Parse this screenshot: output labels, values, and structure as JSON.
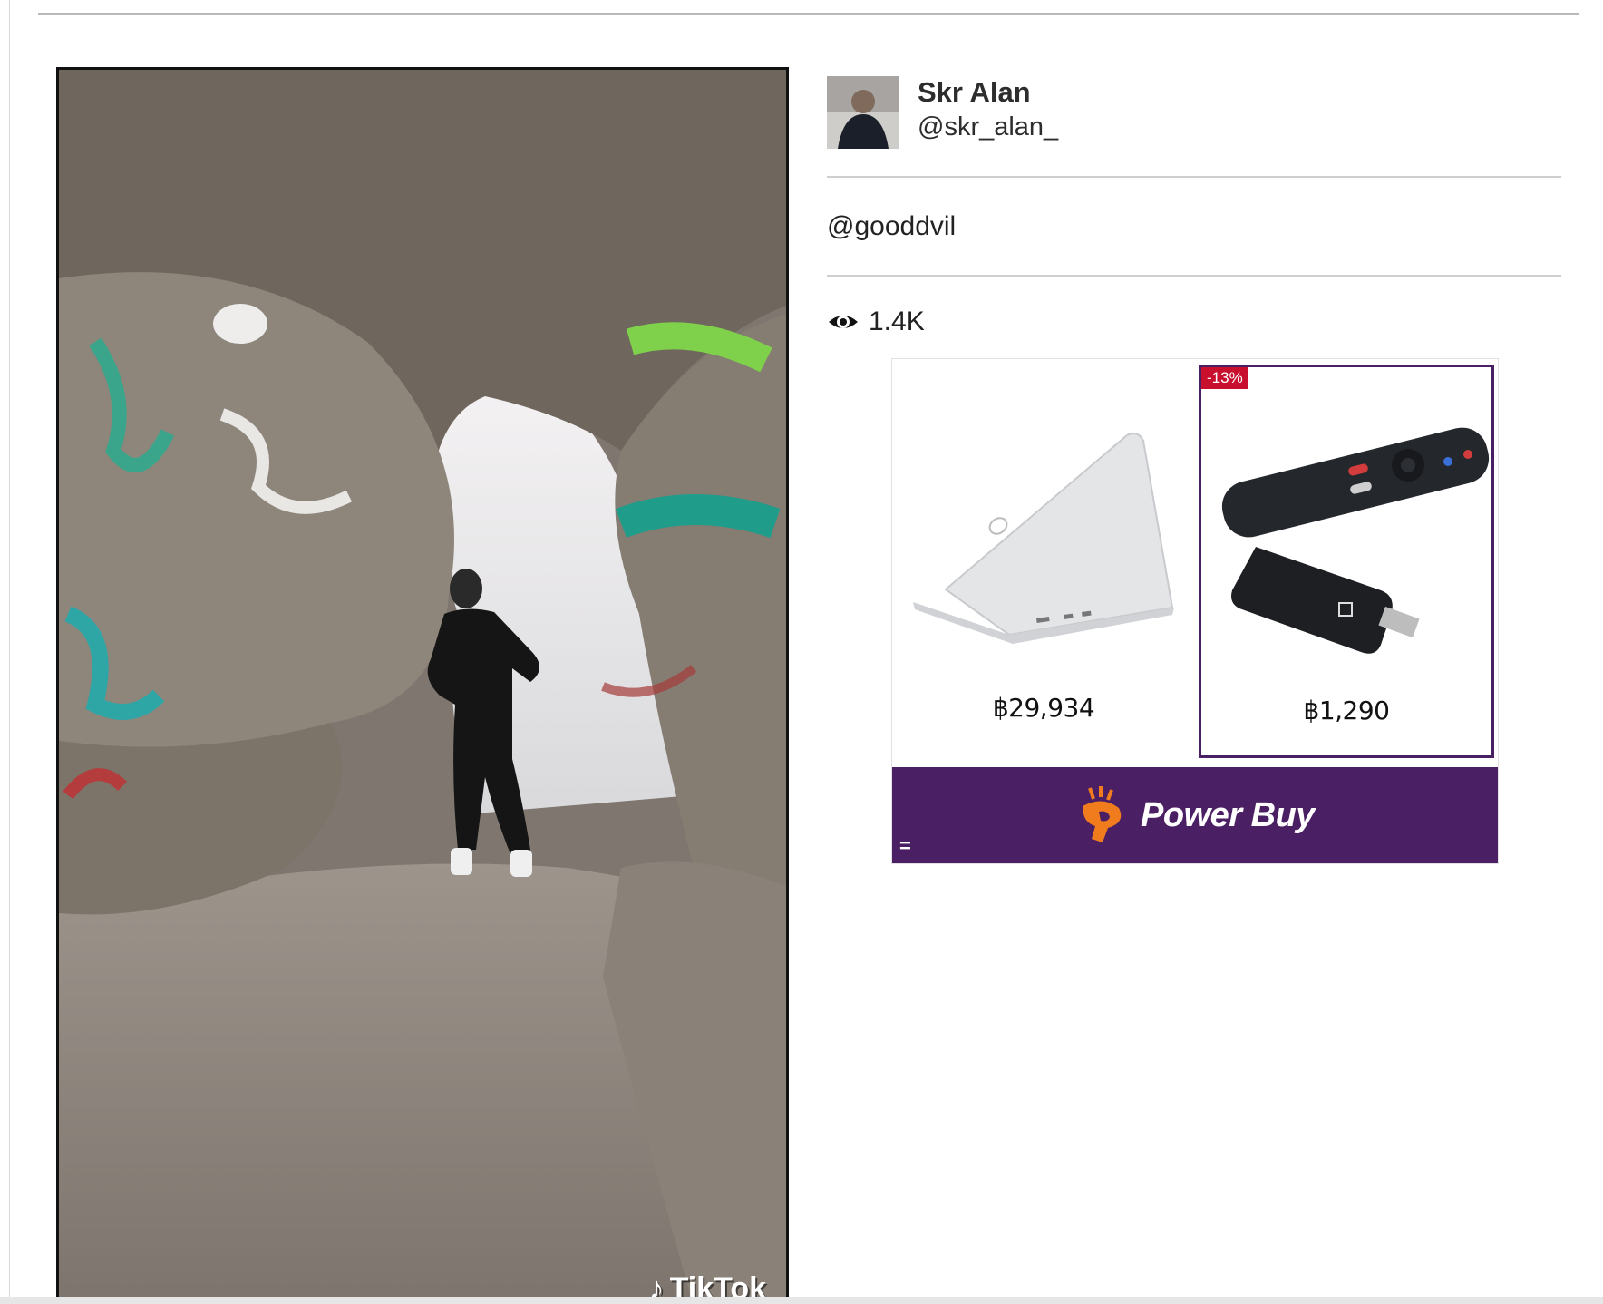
{
  "author": {
    "name": "Skr Alan",
    "handle": "@skr_alan_"
  },
  "post": {
    "caption": "@gooddvil",
    "views": "1.4K"
  },
  "video": {
    "watermark": "TikTok"
  },
  "ad": {
    "products": [
      {
        "name": "laptop",
        "price": "฿29,934",
        "discount": ""
      },
      {
        "name": "tv-streaming-stick",
        "price": "฿1,290",
        "discount": "-13%"
      }
    ],
    "brand": "Power Buy",
    "menu_glyph": "=",
    "colors": {
      "brand_purple": "#4b1f63",
      "discount_red": "#c8102e",
      "logo_orange": "#f07c1d"
    }
  },
  "icons": {
    "views": "eye-icon",
    "tiktok": "tiktok-logo-icon",
    "brand": "power-buy-logo-icon"
  }
}
